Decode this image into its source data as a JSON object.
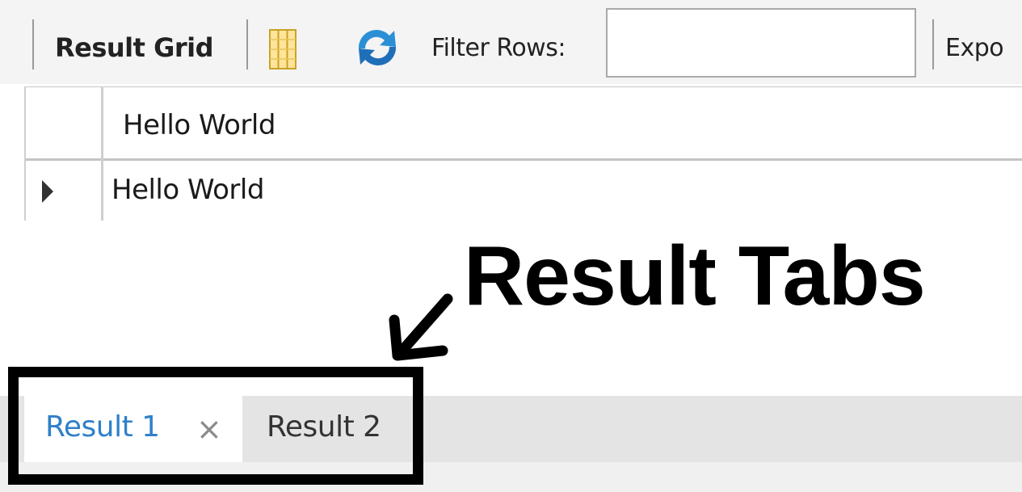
{
  "toolbar": {
    "result_grid_label": "Result Grid",
    "form_editor_icon": "column-toggle-icon",
    "refresh_icon": "refresh-icon",
    "filter_label": "Filter Rows:",
    "filter_value": "",
    "export_label": "Expo"
  },
  "grid": {
    "columns": [
      "Hello World"
    ],
    "rows": [
      [
        "Hello World"
      ]
    ]
  },
  "annotation": {
    "text": "Result Tabs"
  },
  "tabs": [
    {
      "label": "Result 1",
      "active": true,
      "close_glyph": "×"
    },
    {
      "label": "Result 2",
      "active": false
    }
  ],
  "colors": {
    "active_tab_text": "#2f80c9",
    "inactive_tab_text": "#333333",
    "tab_strip": "#e4e4e4"
  }
}
